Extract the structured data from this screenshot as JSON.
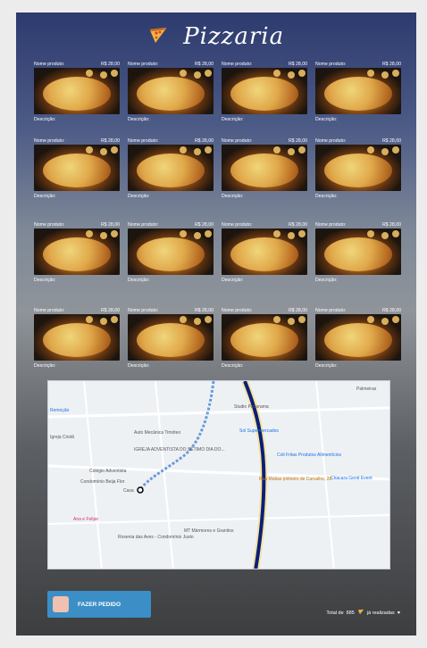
{
  "title": "Pizzaria",
  "product_label": "Nome produto:",
  "price_label": "R$ 28,00",
  "description_label": "Descrição:",
  "map": {
    "labels": [
      "Palmeiras",
      "Studio Panorama",
      "Sol Supermercados",
      "Coli Fritas Produtos Alimentícios",
      "Chácara Genê Event",
      "Auto Mecânica Timóteo",
      "IGREJA ADVENTISTA DO SÉTIMO DIA DO...",
      "Colégio Adventista",
      "Condomínio Beija Flor",
      "Casa",
      "Rua Matias pinheiro de Carvalho, 28",
      "Ana e Felipe",
      "Rosenia das Aves - Condomínio Justo",
      "MT Mármores e Granitos",
      "Remoção",
      "Igreja Cristã"
    ]
  },
  "order_button": "FAZER PEDIDO",
  "footer": {
    "prefix": "Total de",
    "count": "885",
    "suffix": "já realizadas"
  }
}
